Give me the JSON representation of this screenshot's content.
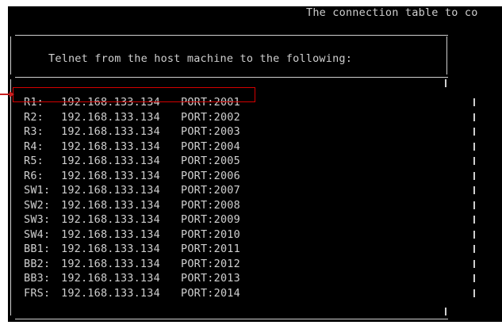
{
  "header_text": "The connection table to co",
  "box_title": "Telnet from the host machine to the following:",
  "rows": [
    {
      "name": "R1:",
      "ip": "192.168.133.134",
      "port": "PORT:2001"
    },
    {
      "name": "R2:",
      "ip": "192.168.133.134",
      "port": "PORT:2002"
    },
    {
      "name": "R3:",
      "ip": "192.168.133.134",
      "port": "PORT:2003"
    },
    {
      "name": "R4:",
      "ip": "192.168.133.134",
      "port": "PORT:2004"
    },
    {
      "name": "R5:",
      "ip": "192.168.133.134",
      "port": "PORT:2005"
    },
    {
      "name": "R6:",
      "ip": "192.168.133.134",
      "port": "PORT:2006"
    },
    {
      "name": "SW1:",
      "ip": "192.168.133.134",
      "port": "PORT:2007"
    },
    {
      "name": "SW2:",
      "ip": "192.168.133.134",
      "port": "PORT:2008"
    },
    {
      "name": "SW3:",
      "ip": "192.168.133.134",
      "port": "PORT:2009"
    },
    {
      "name": "SW4:",
      "ip": "192.168.133.134",
      "port": "PORT:2010"
    },
    {
      "name": "BB1:",
      "ip": "192.168.133.134",
      "port": "PORT:2011"
    },
    {
      "name": "BB2:",
      "ip": "192.168.133.134",
      "port": "PORT:2012"
    },
    {
      "name": "BB3:",
      "ip": "192.168.133.134",
      "port": "PORT:2013"
    },
    {
      "name": "FRS:",
      "ip": "192.168.133.134",
      "port": "PORT:2014"
    }
  ],
  "colors": {
    "terminal_background": "#000000",
    "terminal_text": "#cfcfcf",
    "highlight_annotation": "#d40000"
  }
}
